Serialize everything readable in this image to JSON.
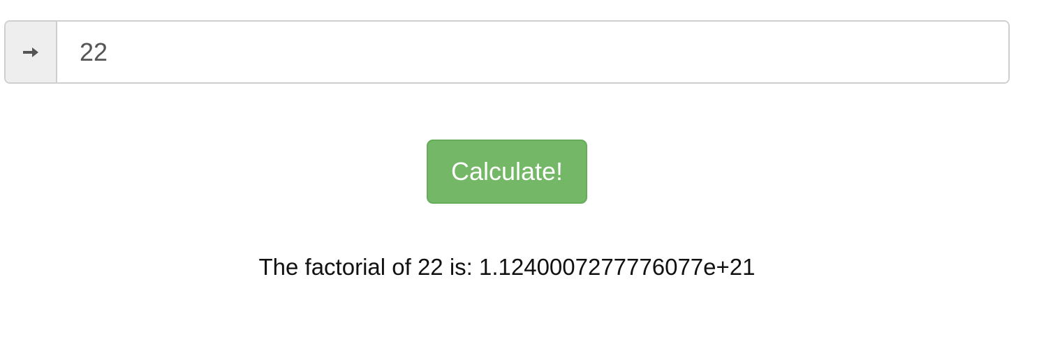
{
  "input": {
    "icon": "arrow-right-icon",
    "value": "22"
  },
  "button": {
    "label": "Calculate!",
    "color": "#73b767"
  },
  "result": {
    "text": "The factorial of 22 is: 1.1240007277776077e+21"
  }
}
